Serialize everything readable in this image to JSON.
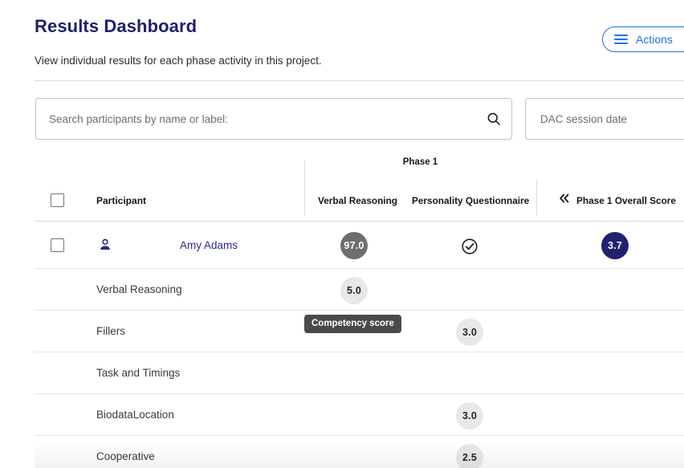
{
  "header": {
    "title": "Results Dashboard",
    "subtitle": "View individual results for each phase activity in this project.",
    "actions_label": "Actions",
    "actions_icon": "hamburger-menu-icon",
    "accent_color": "#1a73e8",
    "title_color": "#1f1f6e"
  },
  "filters": {
    "search": {
      "placeholder": "Search participants by name or label:",
      "value": "",
      "icon": "search-icon"
    },
    "date": {
      "placeholder": "DAC session date",
      "value": ""
    }
  },
  "table": {
    "group_header": "Phase 1",
    "columns": {
      "select_all": "",
      "participant": "Participant",
      "verbal_reasoning": "Verbal Reasoning",
      "personality_questionnaire": "Personality Questionnaire",
      "phase1_overall_score": "Phase 1 Overall Score"
    },
    "collapse_icon": "chevron-double-left-icon",
    "participant_row": {
      "name": "Amy Adams",
      "avatar_icon": "person-icon",
      "verbal_reasoning_score": "97.0",
      "verbal_reasoning_badge_color": "#6e6e6e",
      "personality_questionnaire_status": "check-circle-icon",
      "phase1_overall_score": "3.7",
      "phase1_badge_color": "#23216e"
    },
    "detail_rows": [
      {
        "label": "Verbal Reasoning",
        "verbal_reasoning_score": "5.0",
        "personality_score": ""
      },
      {
        "label": "Fillers",
        "verbal_reasoning_score": "",
        "personality_score": "3.0"
      },
      {
        "label": "Task and Timings",
        "verbal_reasoning_score": "",
        "personality_score": ""
      },
      {
        "label": "BiodataLocation",
        "verbal_reasoning_score": "",
        "personality_score": "3.0"
      },
      {
        "label": "Cooperative",
        "verbal_reasoning_score": "",
        "personality_score": "2.5"
      }
    ]
  },
  "tooltip": {
    "text": "Competency score"
  }
}
